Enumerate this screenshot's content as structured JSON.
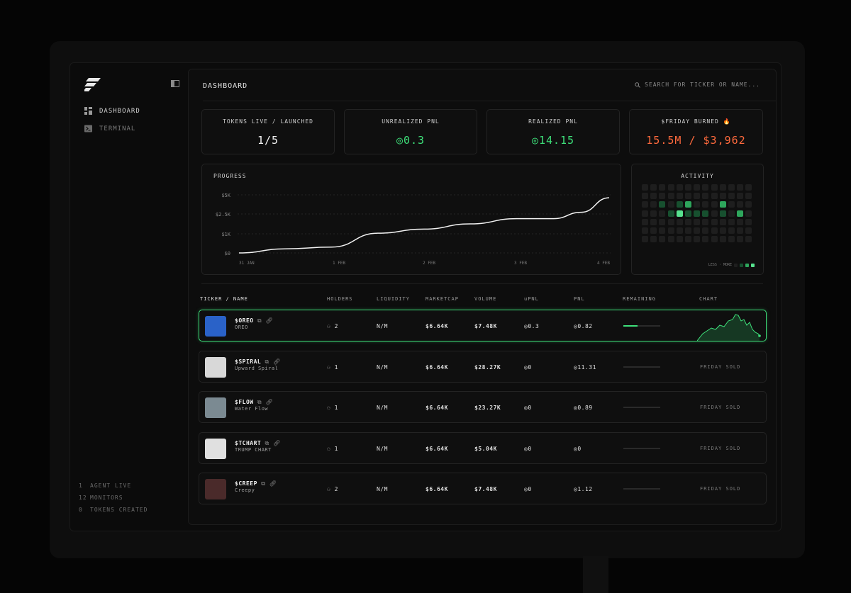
{
  "sidebar": {
    "nav": [
      {
        "label": "DASHBOARD",
        "icon": "grid-icon"
      },
      {
        "label": "TERMINAL",
        "icon": "terminal-icon"
      }
    ],
    "stats": [
      {
        "num": "1",
        "label": "AGENT LIVE"
      },
      {
        "num": "12",
        "label": "MONITORS"
      },
      {
        "num": "0",
        "label": "TOKENS CREATED"
      }
    ]
  },
  "header": {
    "title": "DASHBOARD",
    "search_placeholder": "SEARCH FOR TICKER OR NAME..."
  },
  "cards": [
    {
      "label": "TOKENS LIVE / LAUNCHED",
      "value": "1/5"
    },
    {
      "label": "UNREALIZED PNL",
      "value": "0.3"
    },
    {
      "label": "REALIZED PNL",
      "value": "14.15"
    },
    {
      "label": "$FRIDAY BURNED 🔥",
      "value": "15.5M / $3,962"
    }
  ],
  "progress": {
    "label": "PROGRESS"
  },
  "activity": {
    "label": "ACTIVITY",
    "legend_less": "LESS",
    "legend_more": "MORE",
    "levels": [
      [
        1,
        1,
        1,
        1,
        1,
        1,
        1,
        1,
        1,
        1,
        1,
        1,
        1
      ],
      [
        1,
        1,
        1,
        1,
        1,
        1,
        1,
        1,
        1,
        1,
        1,
        1,
        1
      ],
      [
        1,
        1,
        2,
        1,
        2,
        3,
        1,
        1,
        1,
        3,
        1,
        1,
        1
      ],
      [
        1,
        1,
        1,
        2,
        4,
        2,
        2,
        2,
        1,
        2,
        1,
        3,
        1
      ],
      [
        1,
        1,
        1,
        1,
        1,
        1,
        1,
        1,
        1,
        1,
        1,
        1,
        1
      ],
      [
        1,
        1,
        1,
        1,
        1,
        1,
        1,
        1,
        1,
        1,
        1,
        1,
        1
      ],
      [
        1,
        1,
        1,
        1,
        1,
        1,
        1,
        1,
        1,
        1,
        1,
        1,
        1
      ]
    ],
    "colors": [
      "#1d1d1d",
      "#1e1e1e",
      "#17502f",
      "#2ea65c",
      "#57e38f"
    ]
  },
  "chart_data": {
    "type": "line",
    "title": "PROGRESS",
    "x_ticks": [
      "31 JAN",
      "1 FEB",
      "2 FEB",
      "3 FEB",
      "4 FEB"
    ],
    "y_ticks": [
      "$5K",
      "$2.5K",
      "$1K",
      "$0"
    ],
    "x": [
      0,
      0.5,
      1,
      1.5,
      2,
      2.5,
      3,
      3.4,
      3.7,
      4
    ],
    "values": [
      0,
      0.35,
      0.5,
      1.7,
      2.05,
      2.5,
      2.95,
      2.95,
      3.5,
      4.75
    ]
  },
  "table": {
    "headers": [
      "TICKER / NAME",
      "HOLDERS",
      "LIQUIDITY",
      "MARKETCAP",
      "VOLUME",
      "uPNL",
      "PNL",
      "REMAINING",
      "CHART"
    ],
    "rows": [
      {
        "ticker": "$OREO",
        "name": "OREO",
        "holders": "2",
        "liquidity": "N/M",
        "marketcap": "$6.64K",
        "volume": "$7.48K",
        "upnl": "0.3",
        "pnl": "0.82",
        "remaining": 0.38,
        "status": "",
        "thumb": "#2a62c8",
        "active": true
      },
      {
        "ticker": "$SPIRAL",
        "name": "Upward Spiral",
        "holders": "1",
        "liquidity": "N/M",
        "marketcap": "$6.64K",
        "volume": "$28.27K",
        "upnl": "0",
        "pnl": "11.31",
        "remaining": 0,
        "status": "FRIDAY SOLD",
        "thumb": "#d8d8d8",
        "active": false
      },
      {
        "ticker": "$FLOW",
        "name": "Water Flow",
        "holders": "1",
        "liquidity": "N/M",
        "marketcap": "$6.64K",
        "volume": "$23.27K",
        "upnl": "0",
        "pnl": "0.89",
        "remaining": 0,
        "status": "FRIDAY SOLD",
        "thumb": "#7b8a92",
        "active": false
      },
      {
        "ticker": "$TCHART",
        "name": "TRUMP CHART",
        "holders": "1",
        "liquidity": "N/M",
        "marketcap": "$6.64K",
        "volume": "$5.04K",
        "upnl": "0",
        "pnl": "0",
        "remaining": 0,
        "status": "FRIDAY SOLD",
        "thumb": "#e0e0e0",
        "active": false
      },
      {
        "ticker": "$CREEP",
        "name": "Creepy",
        "holders": "2",
        "liquidity": "N/M",
        "marketcap": "$6.64K",
        "volume": "$7.48K",
        "upnl": "0",
        "pnl": "1.12",
        "remaining": 0,
        "status": "FRIDAY SOLD",
        "thumb": "#4a2a2a",
        "active": false
      }
    ]
  }
}
